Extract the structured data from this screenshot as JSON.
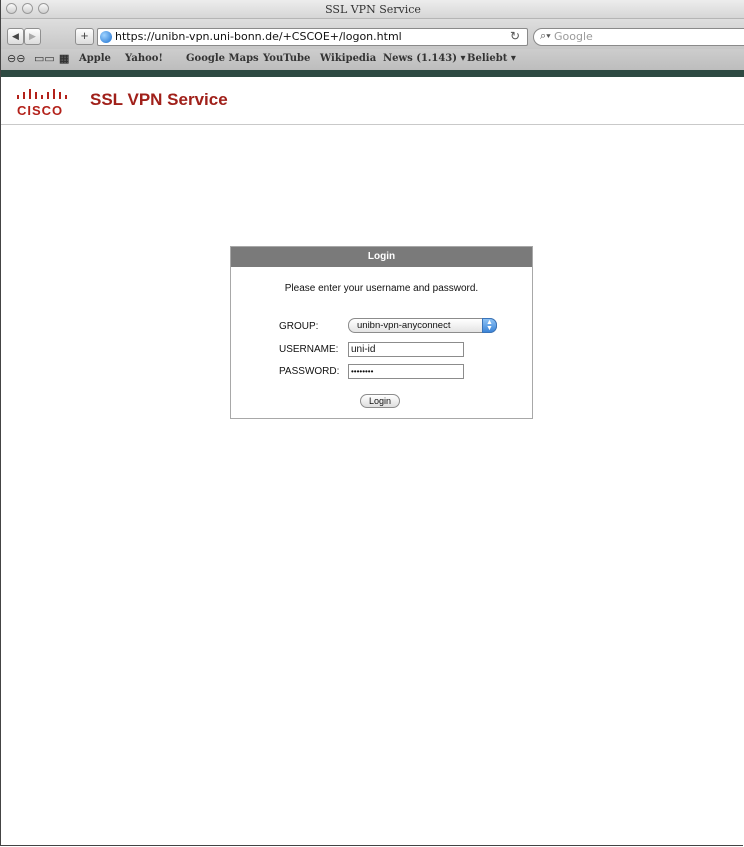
{
  "browser": {
    "window_title": "SSL VPN Service",
    "back_icon": "back-arrow-icon",
    "forward_icon": "forward-arrow-icon",
    "add_icon": "plus-icon",
    "url": "https://unibn-vpn.uni-bonn.de/+CSCOE+/logon.html",
    "reload_icon": "reload-icon",
    "search_placeholder": "Google",
    "bookmarks": [
      "Apple",
      "Yahoo!",
      "Google Maps",
      "YouTube",
      "Wikipedia",
      "News (1.143) ▾",
      "Beliebt ▾"
    ]
  },
  "header": {
    "logo_text": "CISCO",
    "title": "SSL VPN Service"
  },
  "login": {
    "heading": "Login",
    "prompt": "Please enter your username and password.",
    "group_label": "GROUP:",
    "group_value": "unibn-vpn-anyconnect",
    "username_label": "USERNAME:",
    "username_value": "uni-id",
    "password_label": "PASSWORD:",
    "password_value": "••••••••",
    "button_label": "Login"
  },
  "colors": {
    "brand_red": "#a0201a",
    "login_header_bg": "#7a7a7a",
    "dark_bar": "#2e4a42"
  }
}
